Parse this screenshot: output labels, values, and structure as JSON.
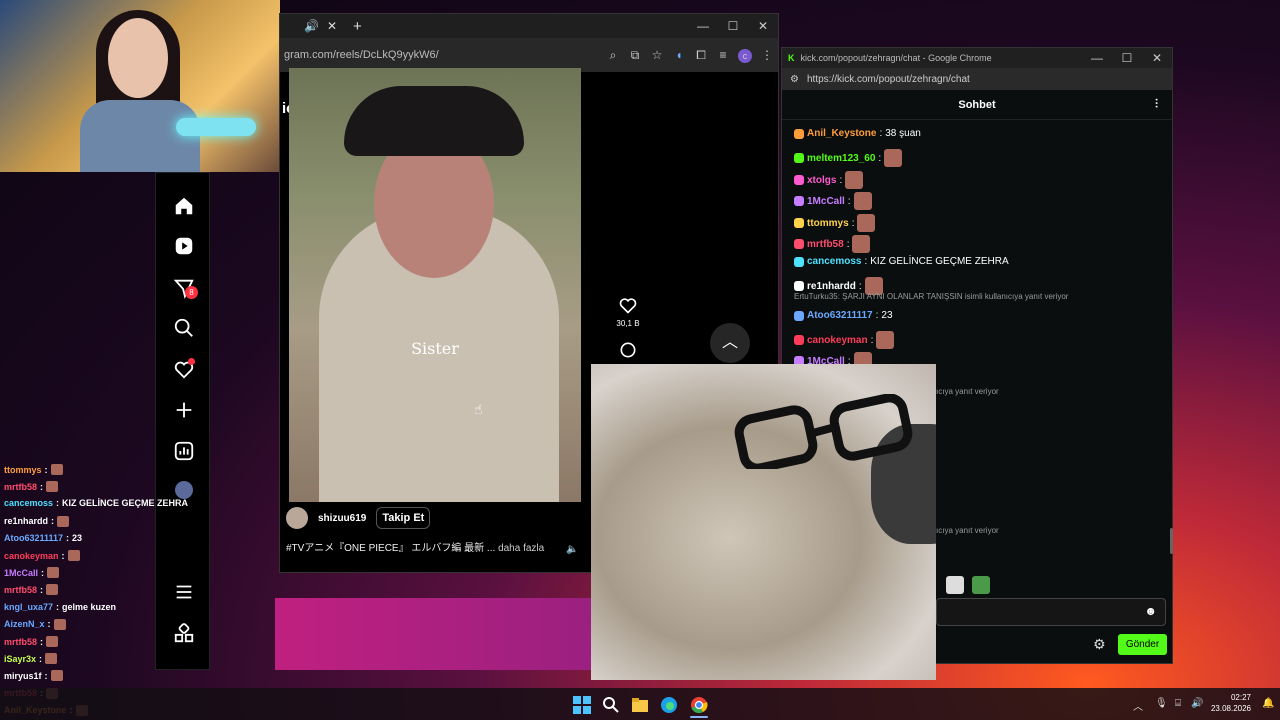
{
  "browser": {
    "url_text": "gram.com/reels/DcLkQ9yykW6/",
    "header_fragment": "için",
    "new_tab_symbol": "+",
    "close_tab_symbol": "✕",
    "profile_initial": "c"
  },
  "instagram": {
    "nav": [
      {
        "name": "home"
      },
      {
        "name": "reels"
      },
      {
        "name": "messages",
        "badge": "8"
      },
      {
        "name": "search"
      },
      {
        "name": "notifications"
      },
      {
        "name": "create"
      },
      {
        "name": "dashboard"
      },
      {
        "name": "profile"
      },
      {
        "name": "more"
      },
      {
        "name": "also-from-meta"
      }
    ],
    "reel": {
      "caption_overlay": "Sister",
      "author": "shizuu619",
      "follow_label": "Takip Et",
      "description": "#TVアニメ『ONE PIECE』 エルバフ編 最新 ...",
      "more_label": "daha fazla",
      "likes": "30,1 B"
    }
  },
  "chat_window": {
    "title": "kick.com/popout/zehragn/chat - Google Chrome",
    "url": "https://kick.com/popout/zehragn/chat",
    "header": "Sohbet",
    "send_label": "Gönder",
    "messages": [
      {
        "user": "Anil_Keystone",
        "text": "38 şuan",
        "color": "#ff9d3b",
        "emote": false
      },
      {
        "user": "meltem123_60",
        "text": "",
        "color": "#53fc18",
        "emote": true
      },
      {
        "user": "xtolgs",
        "text": "",
        "color": "#ff5bd0",
        "emote": true
      },
      {
        "user": "1McCall",
        "text": "",
        "color": "#c77dff",
        "emote": true
      },
      {
        "user": "ttommys",
        "text": "",
        "color": "#ffd24a",
        "emote": true
      },
      {
        "user": "mrtfb58",
        "text": "",
        "color": "#ff4d6d",
        "emote": true
      },
      {
        "user": "cancemoss",
        "text": "KIZ GELİNCE GEÇME ZEHRA",
        "color": "#4de1ff",
        "emote": false
      },
      {
        "user": "re1nhardd",
        "text": "",
        "color": "#ffffff",
        "emote": true
      },
      {
        "user": "Atoo63211117",
        "text": "23",
        "color": "#6aa9ff",
        "emote": false
      },
      {
        "user": "canokeyman",
        "text": "",
        "color": "#ff3d5a",
        "emote": true
      },
      {
        "user": "1McCall",
        "text": "",
        "color": "#c77dff",
        "emote": true
      }
    ],
    "reply_notice": "ErtuTurku35: ŞARJI AYNI OLANLAR TANIŞSIN isimli kullanıcıya yanıt veriyor",
    "partial_reply_1": "ıcıya yanıt veriyor",
    "partial_reply_2": "ıcıya yanıt veriyor"
  },
  "overlay_chat": [
    {
      "user": "ttommys",
      "text": "",
      "color": "#ff9d3b",
      "emote": true
    },
    {
      "user": "mrtfb58",
      "text": "",
      "color": "#ff4d6d",
      "emote": true
    },
    {
      "user": "cancemoss",
      "text": "KIZ GELİNCE GEÇME ZEHRA",
      "color": "#4de1ff",
      "emote": false
    },
    {
      "user": "re1nhardd",
      "text": "",
      "color": "#ffffff",
      "emote": true
    },
    {
      "user": "Atoo63211117",
      "text": "23",
      "color": "#6aa9ff",
      "emote": false
    },
    {
      "user": "canokeyman",
      "text": "",
      "color": "#ff3d5a",
      "emote": true
    },
    {
      "user": "1McCall",
      "text": "",
      "color": "#c77dff",
      "emote": true
    },
    {
      "user": "mrtfb58",
      "text": "",
      "color": "#ff4d6d",
      "emote": true
    },
    {
      "user": "kngl_uxa77",
      "text": "gelme kuzen",
      "color": "#6aa9ff",
      "emote": false
    },
    {
      "user": "AizenN_x",
      "text": "",
      "color": "#6aa9ff",
      "emote": true
    },
    {
      "user": "mrtfb58",
      "text": "",
      "color": "#ff4d6d",
      "emote": true
    },
    {
      "user": "iSayr3x",
      "text": "",
      "color": "#c4ff4d",
      "emote": true
    },
    {
      "user": "miryus1f",
      "text": "",
      "color": "#ffffff",
      "emote": true
    },
    {
      "user": "mrtfb58",
      "text": "",
      "color": "#ff4d6d",
      "emote": true
    },
    {
      "user": "Anil_Keystone",
      "text": "",
      "color": "#ff9d3b",
      "emote": true
    }
  ],
  "taskbar": {
    "time": "02:27",
    "date": "23.08.2026"
  },
  "colors": {
    "kick_green": "#53fc18",
    "insta_badge": "#ff3040"
  }
}
